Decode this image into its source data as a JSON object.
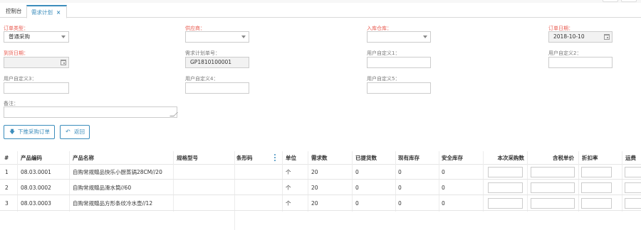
{
  "tabs": [
    {
      "label": "控制台",
      "active": false
    },
    {
      "label": "需求计划",
      "active": true,
      "close": "×"
    }
  ],
  "form": {
    "order_type": {
      "label": "订单类型：",
      "value": "普通采购"
    },
    "supplier": {
      "label": "供应商：",
      "value": ""
    },
    "warehouse": {
      "label": "入库仓库：",
      "value": ""
    },
    "order_date": {
      "label": "订单日期：",
      "value": "2018-10-10"
    },
    "arrival_date": {
      "label": "到货日期：",
      "value": ""
    },
    "plan_no": {
      "label": "需求计划单号：",
      "value": "GP1810100001"
    },
    "custom1": {
      "label": "用户自定义1：",
      "value": ""
    },
    "custom2": {
      "label": "用户自定义2：",
      "value": ""
    },
    "custom3": {
      "label": "用户自定义3：",
      "value": ""
    },
    "custom4": {
      "label": "用户自定义4：",
      "value": ""
    },
    "custom5": {
      "label": "用户自定义5：",
      "value": ""
    },
    "remark": {
      "label": "备注：",
      "value": ""
    }
  },
  "buttons": {
    "push_order": {
      "icon": "🡇",
      "label": "下推采购订单"
    },
    "back": {
      "icon": "↶",
      "label": "返回"
    }
  },
  "table": {
    "headers": {
      "index": "#",
      "code": "产品编码",
      "name": "产品名称",
      "spec": "规格型号",
      "barcode": "条形码",
      "unit": "单位",
      "demand": "需求数",
      "shipped": "已提货数",
      "stock": "现有库存",
      "safety": "安全库存",
      "purchase_qty": "本次采购数",
      "price": "含税单价",
      "discount": "折扣率",
      "freight": "运费"
    },
    "rows": [
      {
        "index": "1",
        "code": "08.03.0001",
        "name": "自购常规赠品快乐小厨蒸锅28CM//20",
        "spec": "",
        "barcode": "",
        "unit": "个",
        "demand": "20",
        "shipped": "0",
        "stock": "0",
        "safety": "0"
      },
      {
        "index": "2",
        "code": "08.03.0002",
        "name": "自购常规赠品滑水筒//60",
        "spec": "",
        "barcode": "",
        "unit": "个",
        "demand": "20",
        "shipped": "0",
        "stock": "0",
        "safety": "0"
      },
      {
        "index": "3",
        "code": "08.03.0003",
        "name": "自购常规赠品方形条纹冷水壶//12",
        "spec": "",
        "barcode": "",
        "unit": "个",
        "demand": "20",
        "shipped": "0",
        "stock": "0",
        "safety": "0"
      }
    ]
  },
  "colors": {
    "accent": "#3c8dbc",
    "required": "#e85a4f"
  }
}
